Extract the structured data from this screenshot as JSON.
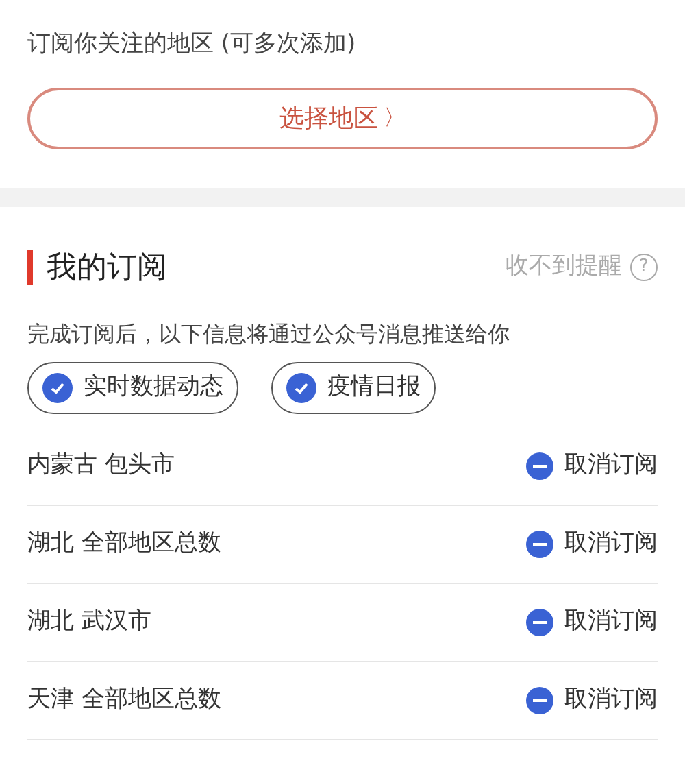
{
  "region_section": {
    "title": "订阅你关注的地区 (可多次添加)",
    "button": {
      "label": "选择地区",
      "arrow": "〉"
    }
  },
  "subscriptions": {
    "title": "我的订阅",
    "help_link": "收不到提醒",
    "help_icon": "?",
    "description": "完成订阅后，以下信息将通过公众号消息推送给你",
    "options": [
      {
        "label": "实时数据动态",
        "checked": true
      },
      {
        "label": "疫情日报",
        "checked": true
      }
    ],
    "regions": [
      {
        "name": "内蒙古 包头市",
        "action": "取消订阅"
      },
      {
        "name": "湖北 全部地区总数",
        "action": "取消订阅"
      },
      {
        "name": "湖北 武汉市",
        "action": "取消订阅"
      },
      {
        "name": "天津 全部地区总数",
        "action": "取消订阅"
      }
    ]
  }
}
